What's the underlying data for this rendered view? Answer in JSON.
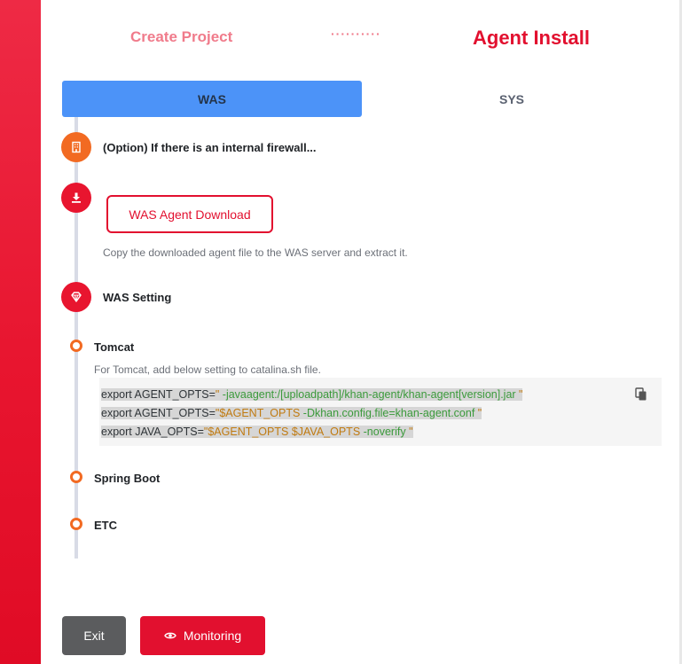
{
  "steps": {
    "create_project": "Create Project",
    "separator": "··········",
    "agent_install": "Agent Install"
  },
  "tabs": [
    {
      "label": "WAS",
      "active": true
    },
    {
      "label": "SYS",
      "active": false
    }
  ],
  "timeline": {
    "firewall_title": "(Option) If there is an internal firewall...",
    "download_button": "WAS Agent Download",
    "download_desc": "Copy the downloaded agent file to the WAS server and extract it.",
    "was_setting_title": "WAS Setting",
    "tomcat": {
      "title": "Tomcat",
      "desc": "For Tomcat, add below setting to catalina.sh file.",
      "code": [
        {
          "prefix": "export AGENT_OPTS=",
          "q1": "\"",
          "body": " -javaagent:/[uploadpath]/khan-agent/khan-agent[version].jar ",
          "q2": "\""
        },
        {
          "prefix": "export AGENT_OPTS=",
          "q1": "\"",
          "var": "$AGENT_OPTS",
          "body": " -Dkhan.config.file=khan-agent.conf ",
          "q2": "\""
        },
        {
          "prefix": "export JAVA_OPTS=",
          "q1": "\"",
          "var": "$AGENT_OPTS $JAVA_OPTS",
          "body": " -noverify ",
          "q2": "\""
        }
      ]
    },
    "spring_boot_title": "Spring Boot",
    "etc_title": "ETC"
  },
  "footer": {
    "exit_label": "Exit",
    "monitoring_label": "Monitoring"
  },
  "icons": {
    "firewall": "building-icon",
    "download": "download-icon",
    "was_setting": "gem-icon",
    "copy": "copy-icon",
    "monitoring": "eye-icon"
  },
  "colors": {
    "accent_red": "#e2102f",
    "tab_active": "#4c93f8",
    "timeline_orange": "#f26a22"
  }
}
